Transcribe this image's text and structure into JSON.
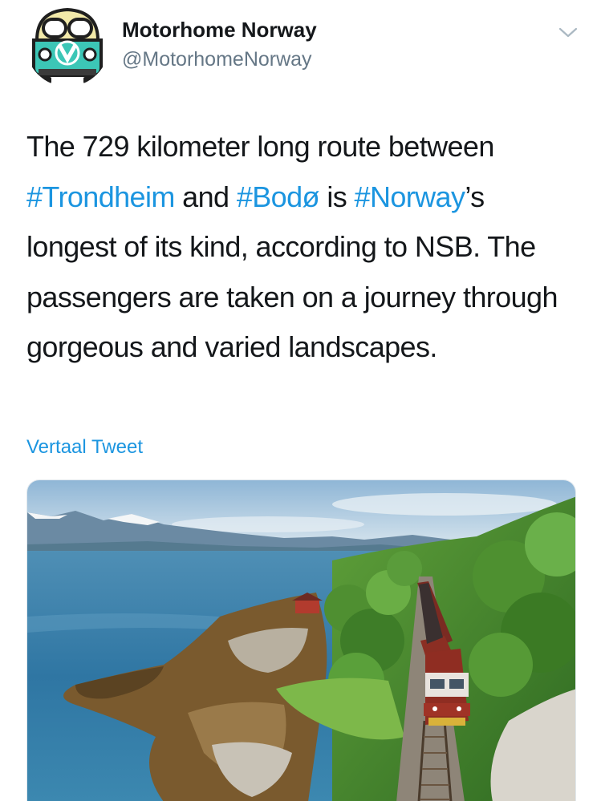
{
  "tweet": {
    "author": {
      "name": "Motorhome Norway",
      "handle": "@MotorhomeNorway"
    },
    "text": {
      "part1": "The 729 kilometer long route between ",
      "hashtag1": "#Trondheim",
      "part2": " and ",
      "hashtag2": "#Bodø",
      "part3": " is ",
      "hashtag3": "#Norway",
      "part4": "’s longest of its kind, according to NSB. The passengers are taken on a journey through gorgeous and varied landscapes."
    },
    "translate_label": "Vertaal Tweet",
    "icons": {
      "menu": "chevron-down-icon",
      "avatar": "camper-van-logo"
    },
    "colors": {
      "link": "#1b95e0",
      "text": "#14171a",
      "secondary": "#657786",
      "logo_teal": "#3cc6b6",
      "logo_yellow": "#f2e9a9"
    }
  }
}
